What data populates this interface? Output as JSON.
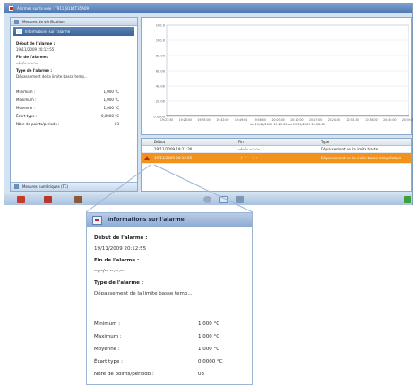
{
  "window": {
    "title": "Alarmes sur la voie : T911_B1b4T35A09"
  },
  "left_panel": {
    "section_title": "Mesures de vérification",
    "selected_header": "Informations sur l'alarme",
    "start_label": "Début de l'alarme :",
    "start_value": "19/11/2009 20:12:55",
    "end_label": "Fin de l'alarme :",
    "end_value": "--/--/-- --:--:--",
    "type_label": "Type de l'alarme :",
    "type_value": "Dépassement de la limite basse temp...",
    "stats": [
      {
        "label": "Minimum :",
        "value": "1,000 °C"
      },
      {
        "label": "Maximum :",
        "value": "1,000 °C"
      },
      {
        "label": "Moyenne :",
        "value": "1,000 °C"
      },
      {
        "label": "Écart type :",
        "value": "0,0000 °C"
      },
      {
        "label": "Nbre de points/périodo :",
        "value": "03"
      }
    ],
    "footer_title": "Mesures numériques (TC)"
  },
  "chart_data": {
    "type": "line",
    "y_ticks": [
      "100.0",
      "100.0",
      "80.00",
      "60.00",
      "40.00",
      "20.00",
      "0.0000"
    ],
    "x_ticks": [
      "19:21:30",
      "19:28:00",
      "19:35:00",
      "19:42:00",
      "19:49:00",
      "19:56:00",
      "20:03:00",
      "20:10:00",
      "20:17:00",
      "20:24:00",
      "20:31:00",
      "20:38:00",
      "20:45:00",
      "20:52:00"
    ],
    "x_date_label": "du 19/11/2009 19:21:30 au 19/11/2009 20:52:00",
    "series": [
      {
        "values": [
          0,
          0,
          0,
          0,
          0,
          0,
          0,
          0,
          0,
          0,
          0,
          0,
          0,
          0
        ]
      }
    ],
    "line_color": "#a020c8"
  },
  "table": {
    "headers": [
      "Début",
      "Fin",
      "Type"
    ],
    "rows": [
      {
        "start": "19/11/2009 19:21:30",
        "end": "--/--/-- --:--:--",
        "type": "Dépassement de la limite haute"
      },
      {
        "start": "19/11/2009 20:12:55",
        "end": "--/--/-- --:--:--",
        "type": "Dépassement de la limite basse température"
      }
    ]
  },
  "popup": {
    "title": "Informations sur l'alarme",
    "start_label": "Début de l'alarme :",
    "start_value": "19/11/2009 20:12:55",
    "end_label": "Fin de l'alarme :",
    "end_value": "--/--/-- --:--:--",
    "type_label": "Type de l'alarme :",
    "type_value": "Dépassement de la limite basse temp...",
    "stats": [
      {
        "label": "Minimum :",
        "value": "1,000 °C"
      },
      {
        "label": "Maximum :",
        "value": "1,000 °C"
      },
      {
        "label": "Moyenne :",
        "value": "1,000 °C"
      },
      {
        "label": "Écart type :",
        "value": "0,0000 °C"
      },
      {
        "label": "Nbre de points/périodo :",
        "value": "03"
      }
    ]
  },
  "colors": {
    "accent": "#3b659b",
    "alarm_row": "#f0921c",
    "alarm_icon": "#c0281f"
  }
}
